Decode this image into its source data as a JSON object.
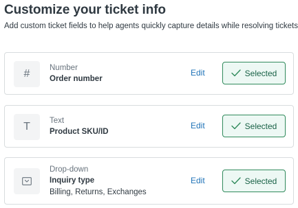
{
  "header": {
    "title": "Customize your ticket info",
    "subtitle": "Add custom ticket fields to help agents quickly capture details while resolving tickets."
  },
  "fields": [
    {
      "type": "Number",
      "name": "Order number",
      "icon": "hash-icon",
      "glyph": "#",
      "edit_label": "Edit",
      "selected_label": "Selected"
    },
    {
      "type": "Text",
      "name": "Product SKU/ID",
      "icon": "text-t-icon",
      "glyph": "T",
      "edit_label": "Edit",
      "selected_label": "Selected"
    },
    {
      "type": "Drop-down",
      "name": "Inquiry type",
      "options": "Billing, Returns, Exchanges",
      "icon": "dropdown-box-icon",
      "edit_label": "Edit",
      "selected_label": "Selected"
    }
  ],
  "colors": {
    "link": "#1f73b7",
    "selected_border": "#2f8a5b",
    "selected_bg": "#edf8f4",
    "selected_text": "#186146"
  }
}
